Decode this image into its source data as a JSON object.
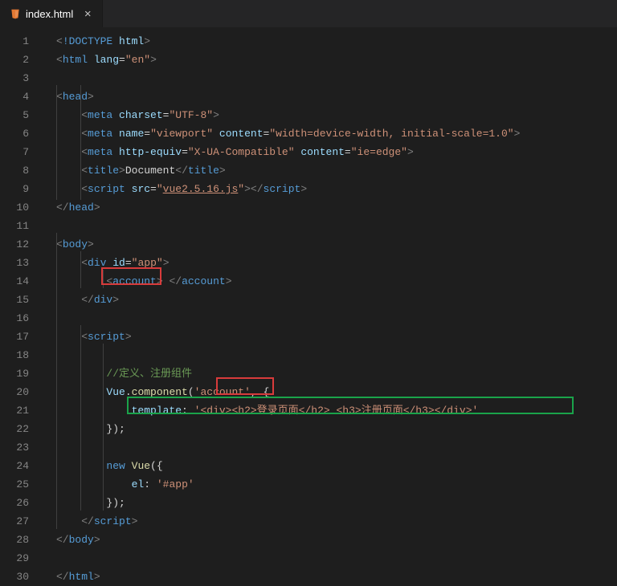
{
  "tab": {
    "filename": "index.html",
    "close_label": "×"
  },
  "gutter": [
    "1",
    "2",
    "3",
    "4",
    "5",
    "6",
    "7",
    "8",
    "9",
    "10",
    "11",
    "12",
    "13",
    "14",
    "15",
    "16",
    "17",
    "18",
    "19",
    "20",
    "21",
    "22",
    "23",
    "24",
    "25",
    "26",
    "27",
    "28",
    "29",
    "30"
  ],
  "code": {
    "l1": {
      "a": "<",
      "b": "!DOCTYPE ",
      "c": "html",
      "d": ">"
    },
    "l2": {
      "a": "<",
      "b": "html ",
      "c": "lang",
      "d": "=",
      "e": "\"en\"",
      "f": ">"
    },
    "l4": {
      "a": "<",
      "b": "head",
      "c": ">"
    },
    "l5": {
      "a": "<",
      "b": "meta ",
      "c": "charset",
      "d": "=",
      "e": "\"UTF-8\"",
      "f": ">"
    },
    "l6": {
      "a": "<",
      "b": "meta ",
      "c": "name",
      "d": "=",
      "e": "\"viewport\"",
      "f": " ",
      "g": "content",
      "h": "=",
      "i": "\"width=device-width, initial-scale=1.0\"",
      "j": ">"
    },
    "l7": {
      "a": "<",
      "b": "meta ",
      "c": "http-equiv",
      "d": "=",
      "e": "\"X-UA-Compatible\"",
      "f": " ",
      "g": "content",
      "h": "=",
      "i": "\"ie=edge\"",
      "j": ">"
    },
    "l8": {
      "a": "<",
      "b": "title",
      "c": ">",
      "d": "Document",
      "e": "</",
      "f": "title",
      "g": ">"
    },
    "l9": {
      "a": "<",
      "b": "script ",
      "c": "src",
      "d": "=",
      "e": "\"",
      "f": "vue2.5.16.js",
      "g": "\"",
      "h": "></",
      "i": "script",
      "j": ">"
    },
    "l10": {
      "a": "</",
      "b": "head",
      "c": ">"
    },
    "l12": {
      "a": "<",
      "b": "body",
      "c": ">"
    },
    "l13": {
      "a": "<",
      "b": "div ",
      "c": "id",
      "d": "=",
      "e": "\"app\"",
      "f": ">"
    },
    "l14": {
      "a": "<",
      "b": "account",
      "c": ">",
      "d": " ",
      "e": "</",
      "f": "account",
      "g": ">"
    },
    "l15": {
      "a": "</",
      "b": "div",
      "c": ">"
    },
    "l17": {
      "a": "<",
      "b": "script",
      "c": ">"
    },
    "l19": {
      "a": "//定义、注册组件"
    },
    "l20": {
      "a": "Vue",
      "b": ".",
      "c": "component",
      "d": "(",
      "e": "'account'",
      "f": ", {"
    },
    "l21": {
      "a": "template",
      "b": ":",
      "c": " ",
      "d": "'<div><h2>登录页面</h2> <h3>注册页面</h3></div>'"
    },
    "l22": {
      "a": "});"
    },
    "l24": {
      "a": "new",
      "b": " ",
      "c": "Vue",
      "d": "({"
    },
    "l25": {
      "a": "el",
      "b": ":",
      "c": " ",
      "d": "'#app'"
    },
    "l26": {
      "a": "});"
    },
    "l27": {
      "a": "</",
      "b": "script",
      "c": ">"
    },
    "l28": {
      "a": "</",
      "b": "body",
      "c": ">"
    },
    "l30": {
      "a": "</",
      "b": "html",
      "c": ">"
    }
  }
}
